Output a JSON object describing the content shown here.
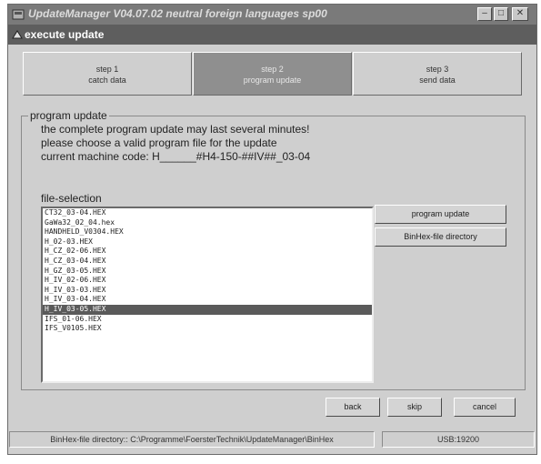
{
  "window": {
    "title": "UpdateManager V04.07.02 neutral foreign languages sp00",
    "icons": {
      "app": "app-icon",
      "minimize": "minimize-icon",
      "maximize": "maximize-icon",
      "close": "close-icon"
    },
    "controls": {
      "minimize": "–",
      "maximize": "□",
      "close": "✕"
    }
  },
  "dialog": {
    "title": "execute update",
    "icon": "app-icon"
  },
  "steps": [
    {
      "line1": "step 1",
      "line2": "catch data",
      "active": false
    },
    {
      "line1": "step 2",
      "line2": "program update",
      "active": true
    },
    {
      "line1": "step 3",
      "line2": "send data",
      "active": false
    }
  ],
  "group": {
    "label": "program update",
    "line1": "the complete program update may last several minutes!",
    "line2": "please choose a valid program file for the update",
    "machine_code_label": "current machine code: H______#H4-150-##IV##_03-04"
  },
  "file_selection": {
    "label": "file-selection",
    "files": [
      "CT32_03-04.HEX",
      "GaWa32_02_04.hex",
      "HANDHELD_V0304.HEX",
      "H_02-03.HEX",
      "H_CZ_02-06.HEX",
      "H_CZ_03-04.HEX",
      "H_GZ_03-05.HEX",
      "H_IV_02-06.HEX",
      "H_IV_03-03.HEX",
      "H_IV_03-04.HEX",
      "H_IV_03-05.HEX",
      "IFS_01-06.HEX",
      "IFS_V0105.HEX"
    ],
    "selected_index": 10
  },
  "buttons": {
    "program_update": "program update",
    "binhex_dir": "BinHex-file directory",
    "back": "back",
    "skip": "skip",
    "cancel": "cancel"
  },
  "status": {
    "directory": "BinHex-file directory:: C:\\Programme\\FoersterTechnik\\UpdateManager\\BinHex",
    "port": "USB:19200"
  },
  "colors": {
    "selected_row": "#5a5a5a",
    "active_step": "#8f8f8f",
    "titlebar": "#7a7a7a"
  }
}
